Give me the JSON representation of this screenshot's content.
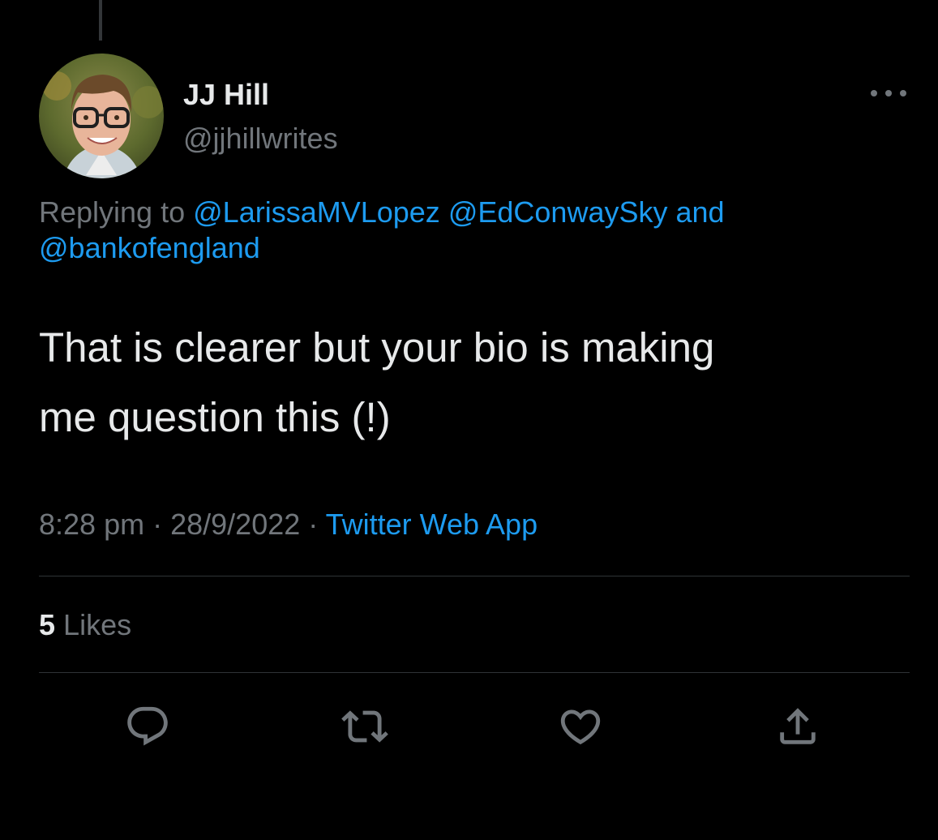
{
  "tweet": {
    "author": {
      "name": "JJ Hill",
      "handle": "@jjhillwrites",
      "avatar_icon": "profile-photo"
    },
    "more_icon": "more-horizontal-icon",
    "replying": {
      "prefix": "Replying to",
      "mentions": [
        "@LarissaMVLopez",
        "@EdConwaySky",
        "@bankofengland"
      ],
      "conjunction": "and"
    },
    "text_line_1": "That is clearer but your bio is making",
    "text_line_2": "me question this (!)",
    "meta": {
      "time": "8:28 pm",
      "separator": "·",
      "date": "28/9/2022",
      "source": "Twitter Web App"
    },
    "stats": {
      "likes_count": "5",
      "likes_label": "Likes"
    },
    "actions": [
      "reply-icon",
      "retweet-icon",
      "like-icon",
      "share-icon"
    ]
  },
  "colors": {
    "background": "#000000",
    "primary_text": "#e7e9ea",
    "secondary_text": "#71767b",
    "link": "#1d9bf0",
    "divider": "#2f3336"
  }
}
